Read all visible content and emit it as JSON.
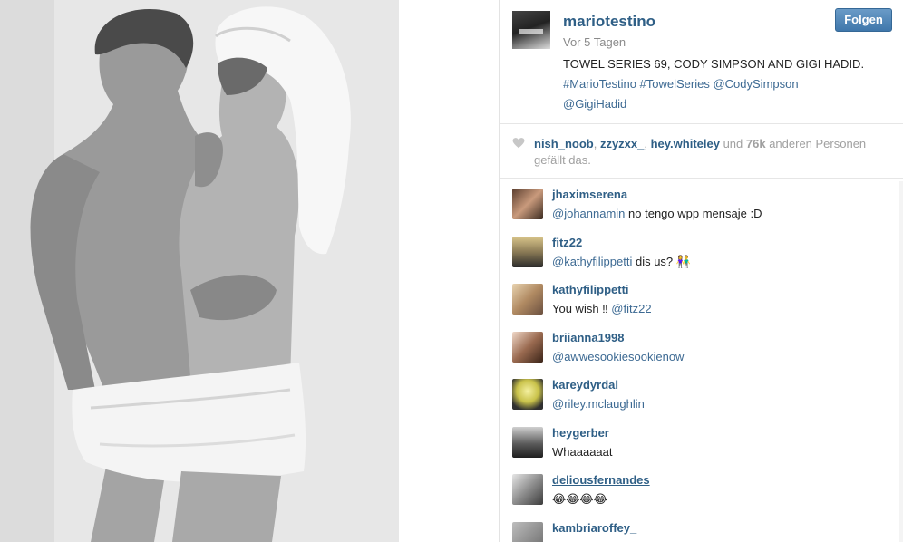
{
  "post": {
    "author": "mariotestino",
    "follow_label": "Folgen",
    "time": "Vor 5 Tagen",
    "caption_line1": "TOWEL SERIES 69, CODY SIMPSON AND GIGI HADID.",
    "caption_tags_line2": "#MarioTestino #TowelSeries @CodySimpson",
    "caption_tags_line3": "@GigiHadid"
  },
  "likes": {
    "user1": "nish_noob",
    "sep1": ", ",
    "user2": "zzyzxx_",
    "sep2": ", ",
    "user3": "hey.whiteley",
    "rest_a": " und ",
    "count": "76k",
    "rest_b": " anderen Personen gefällt das."
  },
  "comments": [
    {
      "user": "jhaximserena",
      "mention": "@johannamin",
      "text": " no tengo wpp mensaje :D",
      "emoji": ""
    },
    {
      "user": "fitz22",
      "mention": "@kathyfilippetti",
      "text": " dis us? ",
      "emoji": "👫"
    },
    {
      "user": "kathyfilippetti",
      "mention": "",
      "text": "You wish ‼ ",
      "mention_after": "@fitz22",
      "emoji": ""
    },
    {
      "user": "briianna1998",
      "mention": "@awwesookiesookienow",
      "text": "",
      "emoji": ""
    },
    {
      "user": "kareydyrdal",
      "mention": "@riley.mclaughlin",
      "text": "",
      "emoji": ""
    },
    {
      "user": "heygerber",
      "mention": "",
      "text": "Whaaaaaat",
      "emoji": ""
    },
    {
      "user": "deliousfernandes",
      "mention": "",
      "text": "",
      "emoji": "😂😂😂😂"
    },
    {
      "user": "kambriaroffey_",
      "mention": "",
      "text": "",
      "emoji": ""
    }
  ],
  "colors": {
    "link": "#2f5f86",
    "follow_button": "#3f77ab"
  }
}
